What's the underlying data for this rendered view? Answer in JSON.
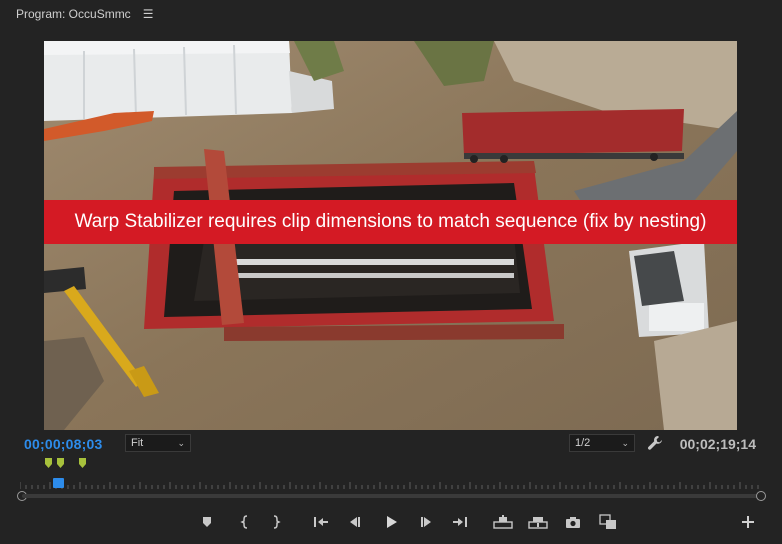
{
  "panel": {
    "title": "Program: OccuSmmc",
    "menu_icon": "hamburger-menu-icon"
  },
  "viewer": {
    "warning": "Warp Stabilizer requires clip dimensions to match sequence (fix by nesting)",
    "warning_color": "#d41a24"
  },
  "controls": {
    "current_timecode": "00;00;08;03",
    "duration_timecode": "00;02;19;14",
    "zoom_value": "Fit",
    "resolution_value": "1/2",
    "accent_color": "#2d8ceb"
  },
  "transport": {
    "buttons": [
      {
        "name": "add-marker-button",
        "icon": "marker-icon"
      },
      {
        "name": "mark-in-button",
        "icon": "mark-in-icon"
      },
      {
        "name": "mark-out-button",
        "icon": "mark-out-icon"
      },
      {
        "name": "go-to-in-button",
        "icon": "go-to-in-icon"
      },
      {
        "name": "step-back-button",
        "icon": "step-back-icon"
      },
      {
        "name": "play-button",
        "icon": "play-icon"
      },
      {
        "name": "step-forward-button",
        "icon": "step-forward-icon"
      },
      {
        "name": "go-to-out-button",
        "icon": "go-to-out-icon"
      },
      {
        "name": "lift-button",
        "icon": "lift-icon"
      },
      {
        "name": "extract-button",
        "icon": "extract-icon"
      },
      {
        "name": "export-frame-button",
        "icon": "camera-icon"
      },
      {
        "name": "comparison-view-button",
        "icon": "comparison-view-icon"
      },
      {
        "name": "button-editor-button",
        "icon": "plus-icon"
      }
    ]
  }
}
